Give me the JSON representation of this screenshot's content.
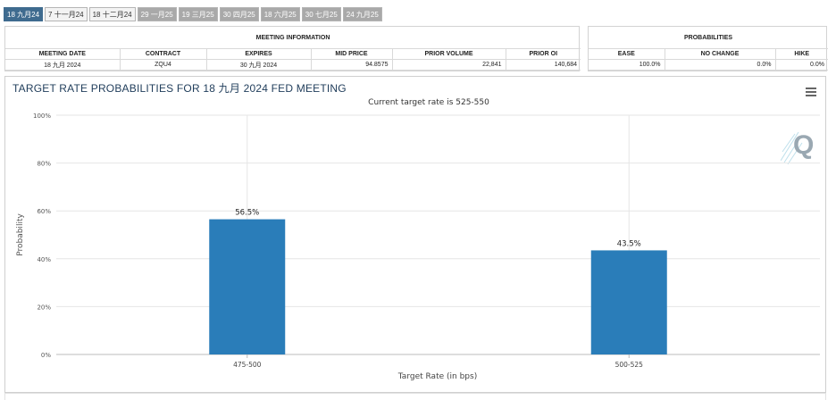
{
  "tabs": [
    {
      "label": "18 九月24",
      "state": "active"
    },
    {
      "label": "7 十一月24",
      "state": "light"
    },
    {
      "label": "18 十二月24",
      "state": "light"
    },
    {
      "label": "29 一月25",
      "state": "dark"
    },
    {
      "label": "19 三月25",
      "state": "dark"
    },
    {
      "label": "30 四月25",
      "state": "dark"
    },
    {
      "label": "18 六月25",
      "state": "dark"
    },
    {
      "label": "30 七月25",
      "state": "dark"
    },
    {
      "label": "24 九月25",
      "state": "dark"
    }
  ],
  "meeting_info": {
    "title": "MEETING INFORMATION",
    "headers": [
      "MEETING DATE",
      "CONTRACT",
      "EXPIRES",
      "MID PRICE",
      "PRIOR VOLUME",
      "PRIOR OI"
    ],
    "row": [
      "18 九月 2024",
      "ZQU4",
      "30 九月 2024",
      "94.8575",
      "22,841",
      "140,684"
    ]
  },
  "probabilities": {
    "title": "PROBABILITIES",
    "headers": [
      "EASE",
      "NO CHANGE",
      "HIKE"
    ],
    "row": [
      "100.0%",
      "0.0%",
      "0.0%"
    ]
  },
  "chart_title": "TARGET RATE PROBABILITIES FOR 18 九月 2024 FED MEETING",
  "chart_data": {
    "type": "bar",
    "title": "TARGET RATE PROBABILITIES FOR 18 九月 2024 FED MEETING",
    "subtitle": "Current target rate is 525-550",
    "xlabel": "Target Rate (in bps)",
    "ylabel": "Probability",
    "categories": [
      "475-500",
      "500-525"
    ],
    "values": [
      56.5,
      43.5
    ],
    "data_labels": [
      "56.5%",
      "43.5%"
    ],
    "ylim": [
      0,
      100
    ],
    "yticks": [
      0,
      20,
      40,
      60,
      80,
      100
    ],
    "ytick_labels": [
      "0%",
      "20%",
      "40%",
      "60%",
      "80%",
      "100%"
    ],
    "bar_color": "#2a7db9",
    "grid": true
  },
  "colors": {
    "accent": "#3f6b8f",
    "title": "#1f3c5a",
    "bar": "#2a7db9"
  },
  "icons": {
    "menu": "hamburger-menu-icon",
    "watermark": "quikstrike-q-logo"
  }
}
